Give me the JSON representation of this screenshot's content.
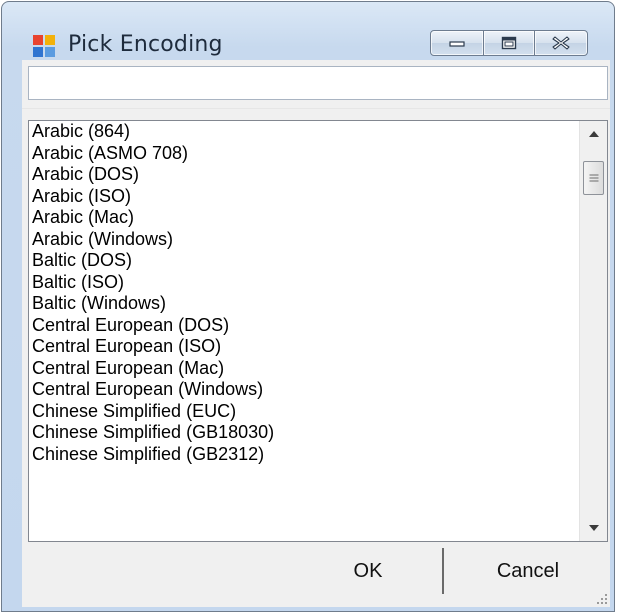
{
  "window": {
    "title": "Pick Encoding",
    "icon": "app-window-icon",
    "controls": [
      "minimize-icon",
      "maximize-icon",
      "close-icon"
    ]
  },
  "search": {
    "value": "",
    "placeholder": ""
  },
  "encodings": [
    "Arabic (864)",
    "Arabic (ASMO 708)",
    "Arabic (DOS)",
    "Arabic (ISO)",
    "Arabic (Mac)",
    "Arabic (Windows)",
    "Baltic (DOS)",
    "Baltic (ISO)",
    "Baltic (Windows)",
    "Central European (DOS)",
    "Central European (ISO)",
    "Central European (Mac)",
    "Central European (Windows)",
    "Chinese Simplified (EUC)",
    "Chinese Simplified (GB18030)",
    "Chinese Simplified (GB2312)"
  ],
  "buttons": {
    "ok": "OK",
    "cancel": "Cancel"
  },
  "colors": {
    "titlebar": "#c4d7ee",
    "client": "#f0f0f0"
  }
}
